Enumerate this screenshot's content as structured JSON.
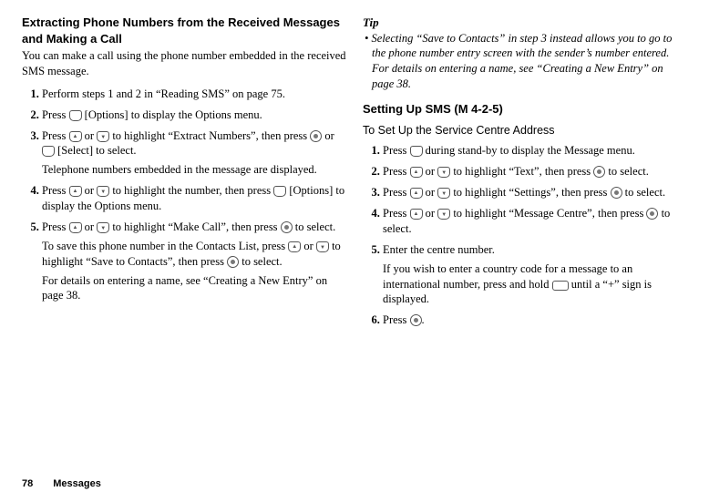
{
  "left": {
    "title": "Extracting Phone Numbers from the Received Messages and Making a Call",
    "intro": "You can make a call using the phone number embedded in the received SMS message.",
    "step1": "Perform steps 1 and 2 in “Reading SMS” on page 75.",
    "step2a": "Press ",
    "step2b": " [Options] to display the Options menu.",
    "step3a": "Press ",
    "step3or": " or ",
    "step3b": " to highlight “Extract Numbers”, then press ",
    "step3or2": " or ",
    "step3c": " [Select] to select.",
    "step3sub": "Telephone numbers embedded in the message are displayed.",
    "step4a": "Press ",
    "step4or": " or ",
    "step4b": " to highlight the number, then press ",
    "step4c": " [Options] to display the Options menu.",
    "step5a": "Press ",
    "step5or": " or ",
    "step5b": " to highlight “Make Call”, then press ",
    "step5c": " to select.",
    "step5sub1a": "To save this phone number in the Contacts List, press ",
    "step5sub1b": " or ",
    "step5sub1c": " to highlight “Save to Contacts”, then press ",
    "step5sub1d": " to select.",
    "step5sub2": "For details on entering a name, see “Creating a New Entry” on page 38."
  },
  "right": {
    "tipHead": "Tip",
    "tipBullet": "• ",
    "tip1": "Selecting “Save to Contacts” in step 3 instead allows you to go to the phone number entry screen with the sender’s number entered.",
    "tip2": "For details on entering a name, see “Creating a New Entry” on page 38.",
    "smsHead": "Setting Up SMS ",
    "smsCode": "(M 4-2-5)",
    "subhead": "To Set Up the Service Centre Address",
    "s1a": "Press ",
    "s1b": " during stand-by to display the Message menu.",
    "s2a": "Press ",
    "s2or": " or ",
    "s2b": " to highlight “Text”, then press ",
    "s2c": " to select.",
    "s3a": "Press ",
    "s3or": " or ",
    "s3b": " to highlight “Settings”, then press ",
    "s3c": " to select.",
    "s4a": "Press ",
    "s4or": " or ",
    "s4b": " to highlight “Message Centre”, then press ",
    "s4c": " to select.",
    "s5": "Enter the centre number.",
    "s5suba": "If you wish to enter a country code for a message to an international number, press and hold ",
    "s5subb": " until a “+” sign is displayed.",
    "s6a": "Press ",
    "s6b": "."
  },
  "footer": {
    "page": "78",
    "section": "Messages"
  }
}
